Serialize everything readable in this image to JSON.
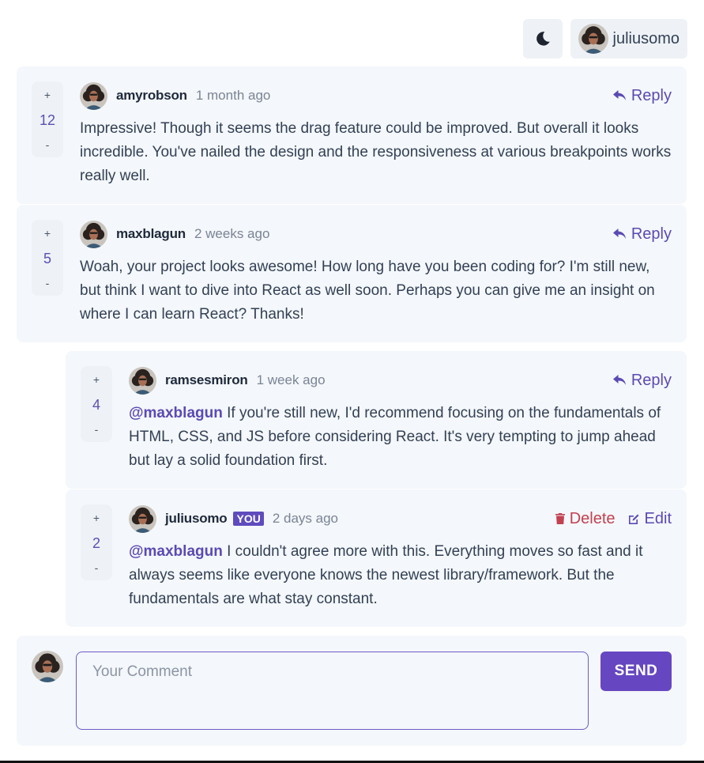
{
  "current_user": {
    "username": "juliusomo"
  },
  "comments": [
    {
      "username": "amyrobson",
      "time": "1 month ago",
      "score": "12",
      "plus": "+",
      "minus": "-",
      "reply_label": "Reply",
      "text": "Impressive! Though it seems the drag feature could be improved. But overall it looks incredible. You've nailed the design and the responsiveness at various breakpoints works really well."
    },
    {
      "username": "maxblagun",
      "time": "2 weeks ago",
      "score": "5",
      "plus": "+",
      "minus": "-",
      "reply_label": "Reply",
      "text": "Woah, your project looks awesome! How long have you been coding for? I'm still new, but think I want to dive into React as well soon. Perhaps you can give me an insight on where I can learn React? Thanks!"
    }
  ],
  "replies": [
    {
      "username": "ramsesmiron",
      "time": "1 week ago",
      "score": "4",
      "plus": "+",
      "minus": "-",
      "reply_label": "Reply",
      "mention": "@maxblagun",
      "text": " If you're still new, I'd recommend focusing on the fundamentals of HTML, CSS, and JS before considering React. It's very tempting to jump ahead but lay a solid foundation first."
    },
    {
      "username": "juliusomo",
      "you_badge": "YOU",
      "time": "2 days ago",
      "score": "2",
      "plus": "+",
      "minus": "-",
      "delete_label": "Delete",
      "edit_label": "Edit",
      "mention": "@maxblagun",
      "text": " I couldn't agree more with this. Everything moves so fast and it always seems like everyone knows the newest library/framework. But the fundamentals are what stay constant."
    }
  ],
  "composer": {
    "placeholder": "Your Comment",
    "send_label": "SEND"
  },
  "icons": {
    "theme": "moon-icon",
    "reply": "reply-arrow-icon",
    "delete": "trash-icon",
    "edit": "pencil-icon"
  },
  "colors": {
    "accent": "#5a4ab3",
    "danger": "#c24150",
    "card_bg": "#f4f7fb",
    "button_bg": "#6647c1"
  }
}
